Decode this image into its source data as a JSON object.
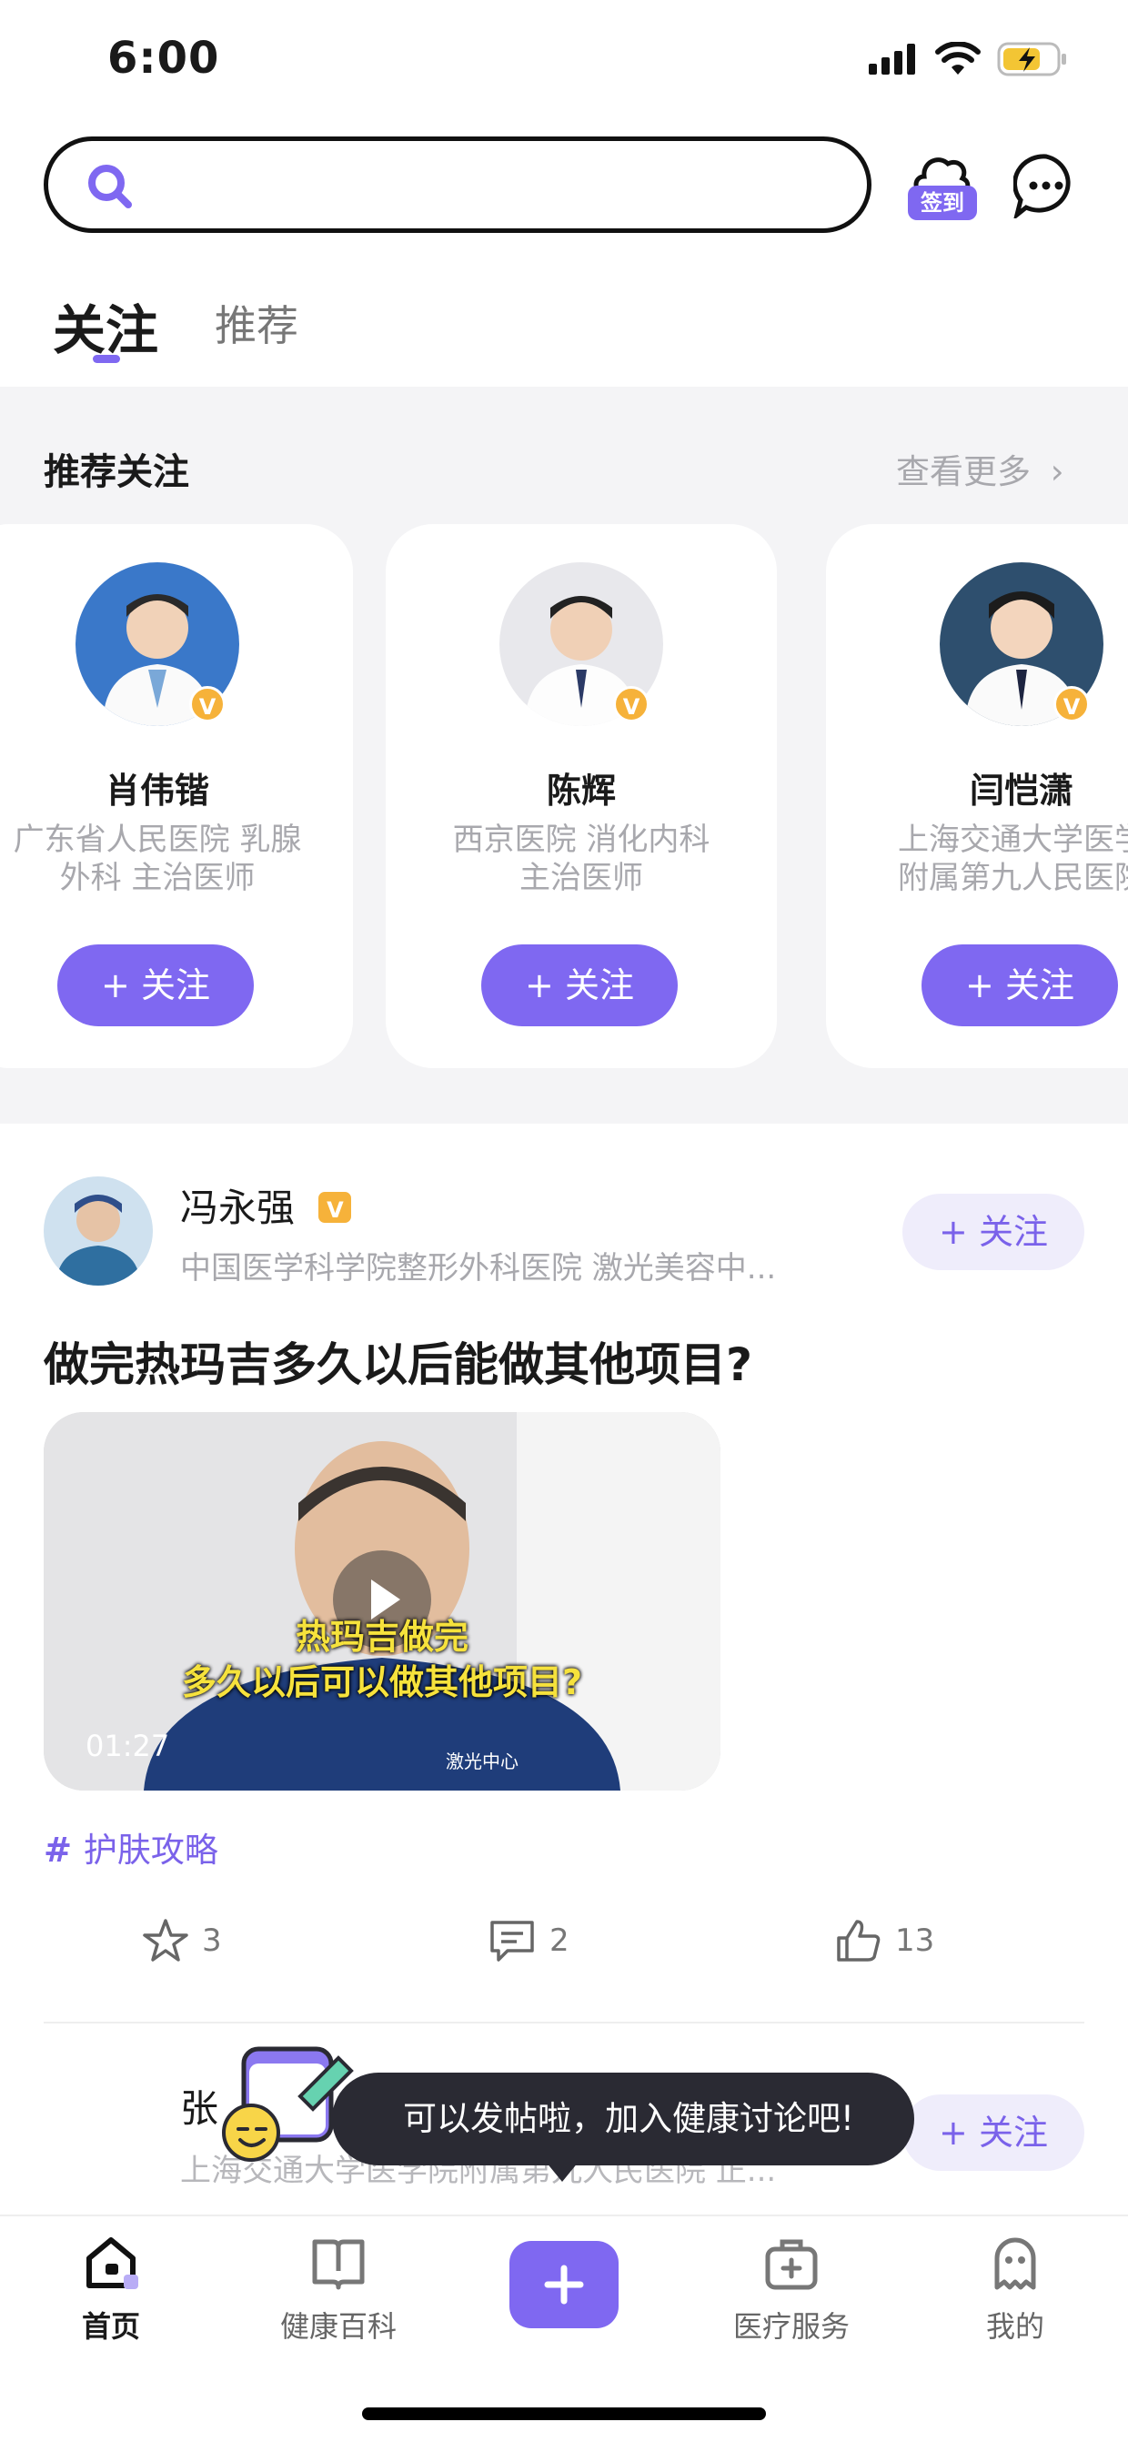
{
  "status_bar": {
    "time": "6:00"
  },
  "header": {
    "search_placeholder": "",
    "checkin_label": "签到"
  },
  "tabs": [
    {
      "label": "关注",
      "active": true
    },
    {
      "label": "推荐",
      "active": false
    }
  ],
  "recommend": {
    "title": "推荐关注",
    "more_label": "查看更多",
    "cards": [
      {
        "name": "肖伟锴",
        "desc_line1": "广东省人民医院 乳腺",
        "desc_line2": "外科 主治医师",
        "follow_label": "关注"
      },
      {
        "name": "陈辉",
        "desc_line1": "西京医院 消化内科",
        "desc_line2": "主治医师",
        "follow_label": "关注"
      },
      {
        "name": "闫恺潇",
        "desc_line1": "上海交通大学医学",
        "desc_line2": "附属第九人民医院",
        "follow_label": "关注"
      }
    ]
  },
  "post": {
    "author": "冯永强",
    "author_desc": "中国医学科学院整形外科医院 激光美容中...",
    "follow_label": "关注",
    "title": "做完热玛吉多久以后能做其他项目?",
    "video": {
      "caption_line1": "热玛吉做完",
      "caption_line2": "多久以后可以做其他项目?",
      "duration": "01:27",
      "shirt_text": "激光中心"
    },
    "tag": "护肤攻略",
    "favorites": "3",
    "comments": "2",
    "likes": "13"
  },
  "post2": {
    "author": "张",
    "author_desc": "上海交通大学医学院附属第九人民医院 正...",
    "follow_label": "关注"
  },
  "tooltip": {
    "text": "可以发帖啦，加入健康讨论吧!"
  },
  "bottom_nav": [
    {
      "label": "首页",
      "icon": "home-icon",
      "active": true
    },
    {
      "label": "健康百科",
      "icon": "book-icon",
      "active": false
    },
    {
      "label": "",
      "icon": "plus-icon",
      "active": false
    },
    {
      "label": "医疗服务",
      "icon": "medical-kit-icon",
      "active": false
    },
    {
      "label": "我的",
      "icon": "profile-icon",
      "active": false
    }
  ],
  "colors": {
    "accent": "#7f68f1",
    "accent_light": "#efedfb",
    "badge": "#f6b23a"
  }
}
